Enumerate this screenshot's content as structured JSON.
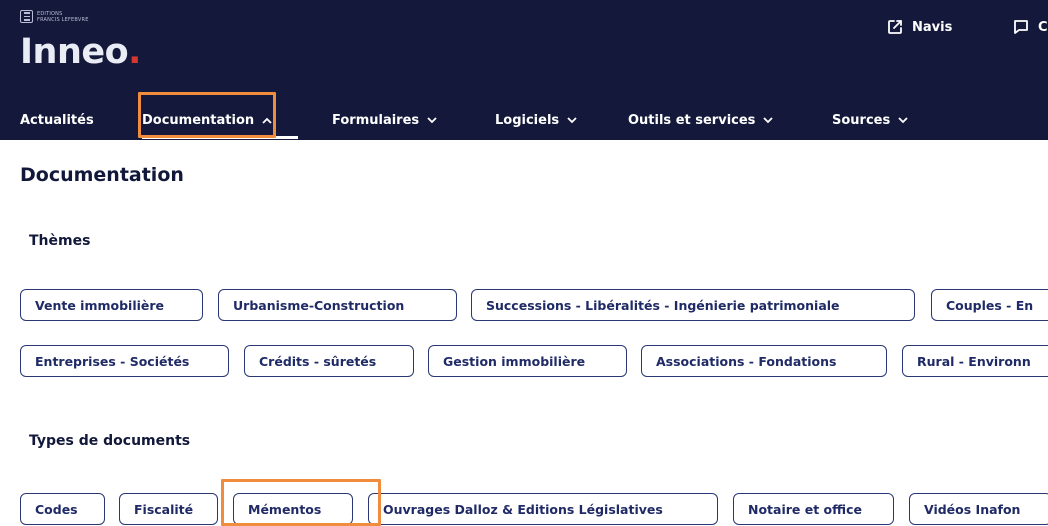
{
  "brand": {
    "publisher": "EDITIONS FRANCIS LEFEBVRE",
    "publisher_line1": "EDITIONS",
    "publisher_line2": "FRANCIS LEFEBVRE",
    "logo_main": "Inneo",
    "logo_dot": "."
  },
  "header_links": [
    {
      "label": "Navis",
      "icon": "external-link-icon"
    },
    {
      "label": "C",
      "icon": "comment-icon"
    }
  ],
  "nav": {
    "items": [
      {
        "label": "Actualités",
        "has_chevron": false
      },
      {
        "label": "Documentation",
        "has_chevron": true,
        "expanded": true
      },
      {
        "label": "Formulaires",
        "has_chevron": true
      },
      {
        "label": "Logiciels",
        "has_chevron": true
      },
      {
        "label": "Outils et services",
        "has_chevron": true
      },
      {
        "label": "Sources",
        "has_chevron": true
      }
    ]
  },
  "page": {
    "title": "Documentation",
    "themes_title": "Thèmes",
    "themes": [
      "Vente immobilière",
      "Urbanisme-Construction",
      "Successions - Libéralités - Ingénierie patrimoniale",
      "Couples - En",
      "Entreprises - Sociétés",
      "Crédits - sûretés",
      "Gestion immobilière",
      "Associations - Fondations",
      "Rural - Environn"
    ],
    "doc_types_title": "Types de documents",
    "doc_types": [
      "Codes",
      "Fiscalité",
      "Mémentos",
      "Ouvrages Dalloz & Editions Législatives",
      "Notaire et office",
      "Vidéos Inafon"
    ]
  },
  "colors": {
    "header_bg": "#14193c",
    "logo_dot": "#d5372f",
    "chip_border": "#2a3774",
    "chip_text": "#1f2a66",
    "highlight": "#ef8c3e"
  }
}
